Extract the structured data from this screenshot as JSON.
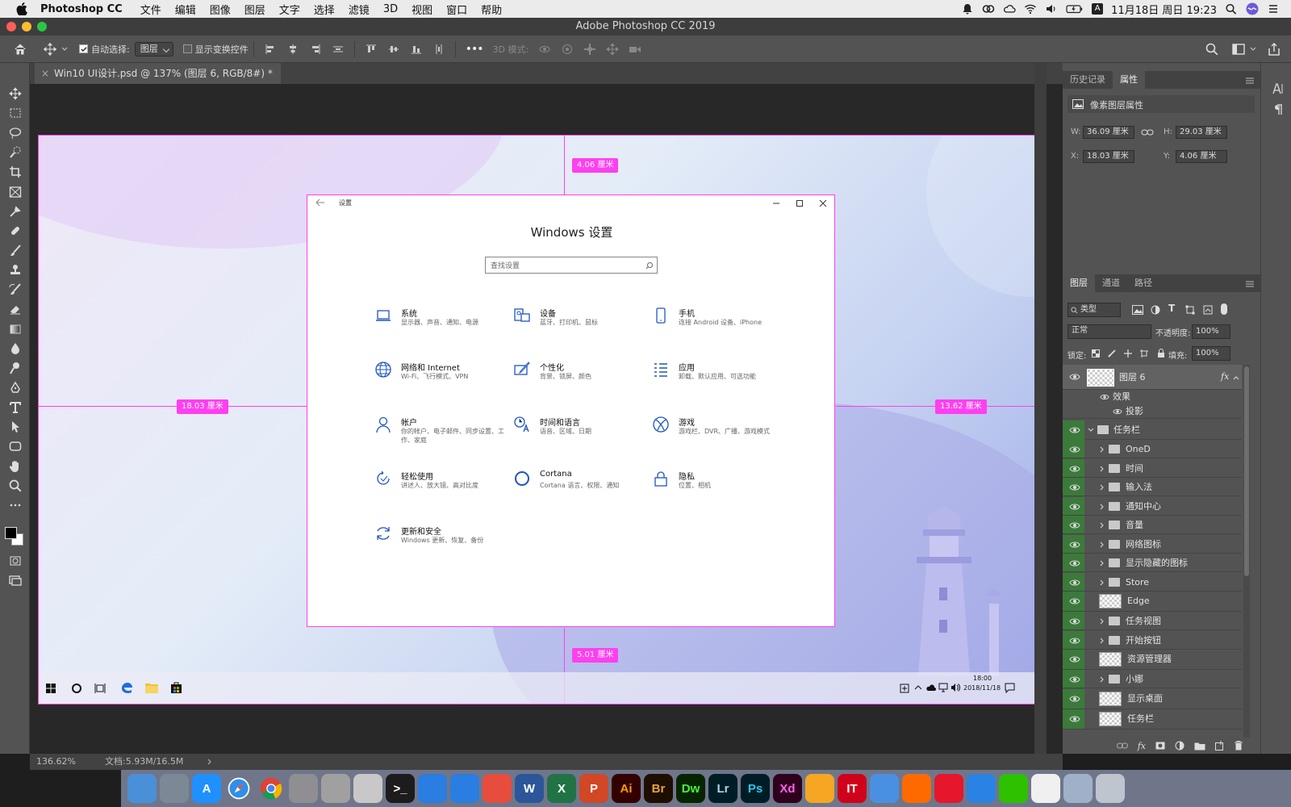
{
  "menubar": {
    "app": "Photoshop CC",
    "items": [
      "文件",
      "编辑",
      "图像",
      "图层",
      "文字",
      "选择",
      "滤镜",
      "3D",
      "视图",
      "窗口",
      "帮助"
    ],
    "datetime": "11月18日 周日 19:23",
    "input_badge": "A"
  },
  "window": {
    "title": "Adobe Photoshop CC 2019"
  },
  "options": {
    "auto_select": "自动选择:",
    "auto_select_value": "图层",
    "show_transform": "显示变换控件",
    "mode_3d": "3D 模式:",
    "more": "•••"
  },
  "document": {
    "tab": "Win10 UI设计.psd @ 137% (图层 6, RGB/8#) *",
    "tab_close": "×",
    "zoom": "136.62%",
    "doc_size": "文档:5.93M/16.5M"
  },
  "measures": {
    "top": "4.06 厘米",
    "left": "18.03 厘米",
    "right": "13.62 厘米",
    "bottom": "5.01 厘米"
  },
  "win_settings": {
    "title": "设置",
    "heading": "Windows 设置",
    "search_placeholder": "查找设置",
    "categories": [
      {
        "title": "系统",
        "desc": "显示器、声音、通知、电源",
        "icon": "laptop-icon"
      },
      {
        "title": "设备",
        "desc": "蓝牙、打印机、鼠标",
        "icon": "devices-icon"
      },
      {
        "title": "手机",
        "desc": "连接 Android 设备、iPhone",
        "icon": "phone-icon"
      },
      {
        "title": "网络和 Internet",
        "desc": "Wi-Fi、飞行模式、VPN",
        "icon": "globe-icon"
      },
      {
        "title": "个性化",
        "desc": "背景、锁屏、颜色",
        "icon": "brush-icon"
      },
      {
        "title": "应用",
        "desc": "卸载、默认应用、可选功能",
        "icon": "apps-icon"
      },
      {
        "title": "帐户",
        "desc": "你的帐户、电子邮件、同步设置、工作、家庭",
        "icon": "person-icon"
      },
      {
        "title": "时间和语言",
        "desc": "语音、区域、日期",
        "icon": "time-language-icon"
      },
      {
        "title": "游戏",
        "desc": "游戏栏、DVR、广播、游戏模式",
        "icon": "xbox-icon"
      },
      {
        "title": "轻松使用",
        "desc": "讲述人、放大镜、高对比度",
        "icon": "ease-icon"
      },
      {
        "title": "Cortana",
        "desc": "Cortana 语言、权限、通知",
        "icon": "cortana-icon"
      },
      {
        "title": "隐私",
        "desc": "位置、相机",
        "icon": "lock-icon"
      },
      {
        "title": "更新和安全",
        "desc": "Windows 更新、恢复、备份",
        "icon": "update-icon"
      }
    ]
  },
  "taskbar": {
    "time": "18:00",
    "date": "2018/11/18"
  },
  "history": {
    "tab1": "历史记录",
    "tab2": "属性",
    "section": "像素图层属性",
    "w_label": "W:",
    "w": "36.09 厘米",
    "h_label": "H:",
    "h": "29.03 厘米",
    "x_label": "X:",
    "x": "18.03 厘米",
    "y_label": "Y:",
    "y": "4.06 厘米"
  },
  "layers_panel": {
    "tabs": [
      "图层",
      "通道",
      "路径"
    ],
    "kind": "类型",
    "blend": "正常",
    "opacity_label": "不透明度:",
    "opacity": "100%",
    "lock_label": "锁定:",
    "fill_label": "填充:",
    "fill": "100%",
    "layers": [
      {
        "name": "图层 6",
        "kind": "thumb",
        "indent": 0,
        "fx": "fx"
      },
      {
        "name": "效果",
        "kind": "effect",
        "indent": 1
      },
      {
        "name": "投影",
        "kind": "effect",
        "indent": 2
      },
      {
        "name": "任务栏",
        "kind": "group-open",
        "indent": 0
      },
      {
        "name": "OneD",
        "kind": "group",
        "indent": 1
      },
      {
        "name": "时间",
        "kind": "group",
        "indent": 1
      },
      {
        "name": "输入法",
        "kind": "group",
        "indent": 1
      },
      {
        "name": "通知中心",
        "kind": "group",
        "indent": 1
      },
      {
        "name": "音量",
        "kind": "group",
        "indent": 1
      },
      {
        "name": "网络图标",
        "kind": "group",
        "indent": 1
      },
      {
        "name": "显示隐藏的图标",
        "kind": "group",
        "indent": 1
      },
      {
        "name": "Store",
        "kind": "group",
        "indent": 1
      },
      {
        "name": "Edge",
        "kind": "thumb",
        "indent": 1
      },
      {
        "name": "任务视图",
        "kind": "group",
        "indent": 1
      },
      {
        "name": "开始按钮",
        "kind": "group",
        "indent": 1
      },
      {
        "name": "资源管理器",
        "kind": "thumb",
        "indent": 1
      },
      {
        "name": "小娜",
        "kind": "group",
        "indent": 1
      },
      {
        "name": "显示桌面",
        "kind": "thumb",
        "indent": 1
      },
      {
        "name": "任务栏",
        "kind": "thumb",
        "indent": 1
      }
    ]
  },
  "dock": [
    {
      "label": "",
      "bg": "#4a90d9",
      "name": "finder-icon"
    },
    {
      "label": "",
      "bg": "#7d8896",
      "name": "launchpad-icon"
    },
    {
      "label": "A",
      "bg": "#1e90ff",
      "name": "app-store-icon"
    },
    {
      "label": "",
      "bg": "#2f8fe8",
      "name": "safari-icon"
    },
    {
      "label": "",
      "bg": "#ffffff",
      "name": "chrome-icon"
    },
    {
      "label": "",
      "bg": "#8e8e93",
      "name": "system-preferences-icon"
    },
    {
      "label": "",
      "bg": "#a0a0a0",
      "name": "utility-icon"
    },
    {
      "label": "",
      "bg": "#c8c8c8",
      "name": "preview-icon"
    },
    {
      "label": ">_",
      "bg": "#1c1c1c",
      "name": "terminal-icon"
    },
    {
      "label": "",
      "bg": "#2a7de1",
      "name": "remote-icon"
    },
    {
      "label": "",
      "bg": "#2a7de1",
      "name": "teamviewer-icon"
    },
    {
      "label": "",
      "bg": "#e84c3d",
      "name": "rocket-icon"
    },
    {
      "label": "W",
      "bg": "#2b579a",
      "name": "word-icon"
    },
    {
      "label": "X",
      "bg": "#217346",
      "name": "excel-icon"
    },
    {
      "label": "P",
      "bg": "#d24726",
      "name": "powerpoint-icon"
    },
    {
      "label": "Ai",
      "bg": "#330000",
      "name": "illustrator-icon",
      "fg": "#ff9a00"
    },
    {
      "label": "Br",
      "bg": "#1e0e00",
      "name": "bridge-icon",
      "fg": "#e8a33d"
    },
    {
      "label": "Dw",
      "bg": "#072401",
      "name": "dreamweaver-icon",
      "fg": "#4af33a"
    },
    {
      "label": "Lr",
      "bg": "#001d26",
      "name": "lightroom-icon",
      "fg": "#add5ec"
    },
    {
      "label": "Ps",
      "bg": "#001d26",
      "name": "photoshop-icon",
      "fg": "#31c5f0"
    },
    {
      "label": "Xd",
      "bg": "#2e001e",
      "name": "xd-icon",
      "fg": "#ff61f6"
    },
    {
      "label": "",
      "bg": "#f5a623",
      "name": "photos-icon"
    },
    {
      "label": "IT",
      "bg": "#d0021b",
      "name": "ithome-icon"
    },
    {
      "label": "",
      "bg": "#4a90e2",
      "name": "baidu-icon"
    },
    {
      "label": "",
      "bg": "#ff6a00",
      "name": "cloud-icon"
    },
    {
      "label": "",
      "bg": "#e6162d",
      "name": "weibo-icon"
    },
    {
      "label": "",
      "bg": "#2a82e4",
      "name": "umbrella-icon"
    },
    {
      "label": "",
      "bg": "#2dc100",
      "name": "wechat-icon"
    },
    {
      "label": "",
      "bg": "#f0f0f0",
      "name": "qq-icon"
    },
    {
      "label": "",
      "bg": "#9fb0c8",
      "name": "screenshot-icon"
    },
    {
      "label": "",
      "bg": "#bfc5cf",
      "name": "trash-icon"
    }
  ]
}
